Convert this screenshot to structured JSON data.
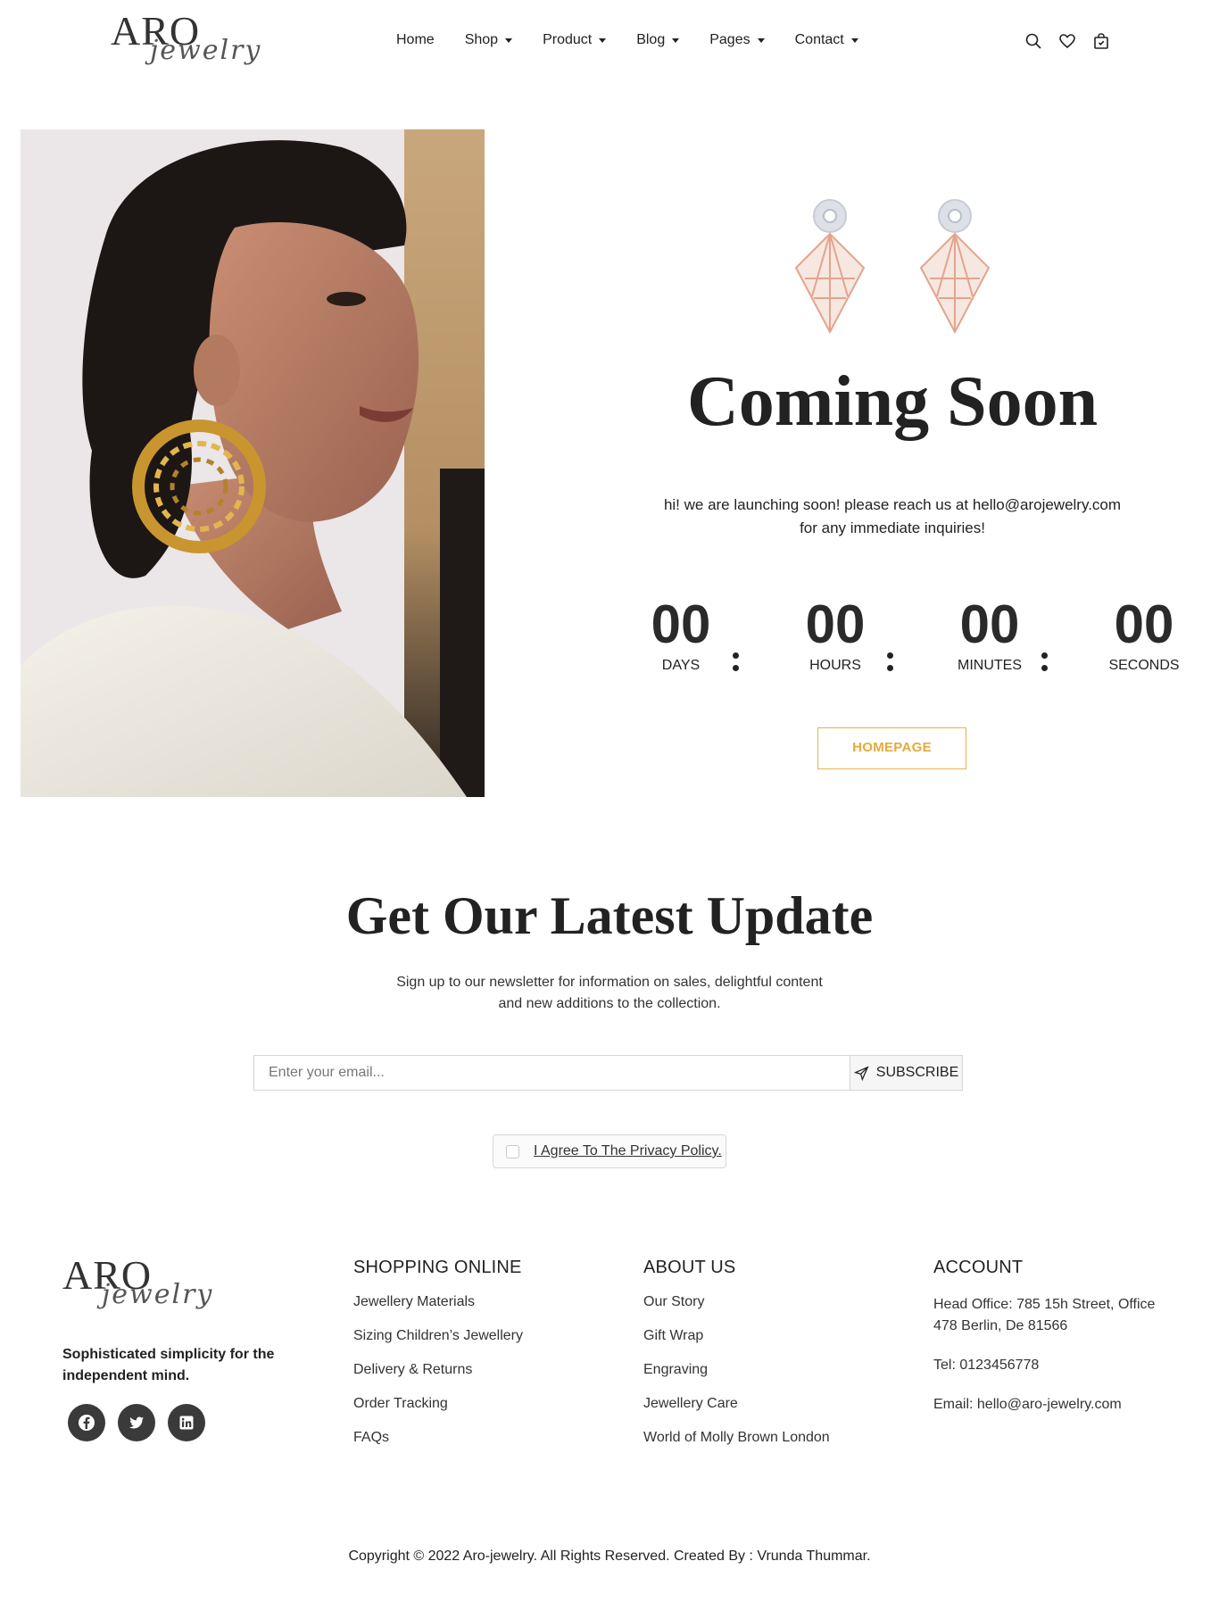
{
  "header": {
    "logo_main": "ARO",
    "logo_script": "jewelry",
    "nav": [
      {
        "label": "Home",
        "dropdown": false
      },
      {
        "label": "Shop",
        "dropdown": true
      },
      {
        "label": "Product",
        "dropdown": true
      },
      {
        "label": "Blog",
        "dropdown": true
      },
      {
        "label": "Pages",
        "dropdown": true
      },
      {
        "label": "Contact",
        "dropdown": true
      }
    ],
    "icons": [
      "search-icon",
      "heart-icon",
      "cart-icon"
    ]
  },
  "hero": {
    "title": "Coming Soon",
    "text_line1": "hi! we are launching soon! please reach us at hello@arojewelry.com",
    "text_line2": "for any immediate inquiries!",
    "countdown": [
      {
        "value": "00",
        "label": "Days"
      },
      {
        "value": "00",
        "label": "Hours"
      },
      {
        "value": "00",
        "label": "Minutes"
      },
      {
        "value": "00",
        "label": "Seconds"
      }
    ],
    "button": "HOMEPAGE"
  },
  "newsletter": {
    "title": "Get Our Latest Update",
    "sub_line1": "Sign up to our newsletter for information on sales, delightful content",
    "sub_line2": "and new additions to the collection.",
    "email_placeholder": "Enter your email...",
    "subscribe": "SUBSCRIBE",
    "agree": "I Agree To The Privacy Policy."
  },
  "footer": {
    "logo_main": "ARO",
    "logo_script": "jewelry",
    "tagline": "Sophisticated simplicity for the independent mind.",
    "social": [
      "facebook-icon",
      "twitter-icon",
      "linkedin-icon"
    ],
    "shopping": {
      "heading": "Shopping Online",
      "links": [
        "Jewellery Materials",
        "Sizing Children’s Jewellery",
        "Delivery & Returns",
        "Order Tracking",
        "FAQs"
      ]
    },
    "about": {
      "heading": "About Us",
      "links": [
        "Our Story",
        "Gift Wrap",
        "Engraving",
        "Jewellery Care",
        "World of Molly Brown London"
      ]
    },
    "account": {
      "heading": "Account",
      "address": "Head Office: 785 15h Street, Office 478 Berlin, De 81566",
      "tel": "Tel: 0123456778",
      "email": "Email: hello@aro-jewelry.com"
    },
    "copyright": "Copyright © 2022 Aro-jewelry. All Rights Reserved. Created By : Vrunda Thummar."
  },
  "colors": {
    "accent": "#e8a93c",
    "text": "#222222",
    "social_bg": "#3a3a3a"
  }
}
